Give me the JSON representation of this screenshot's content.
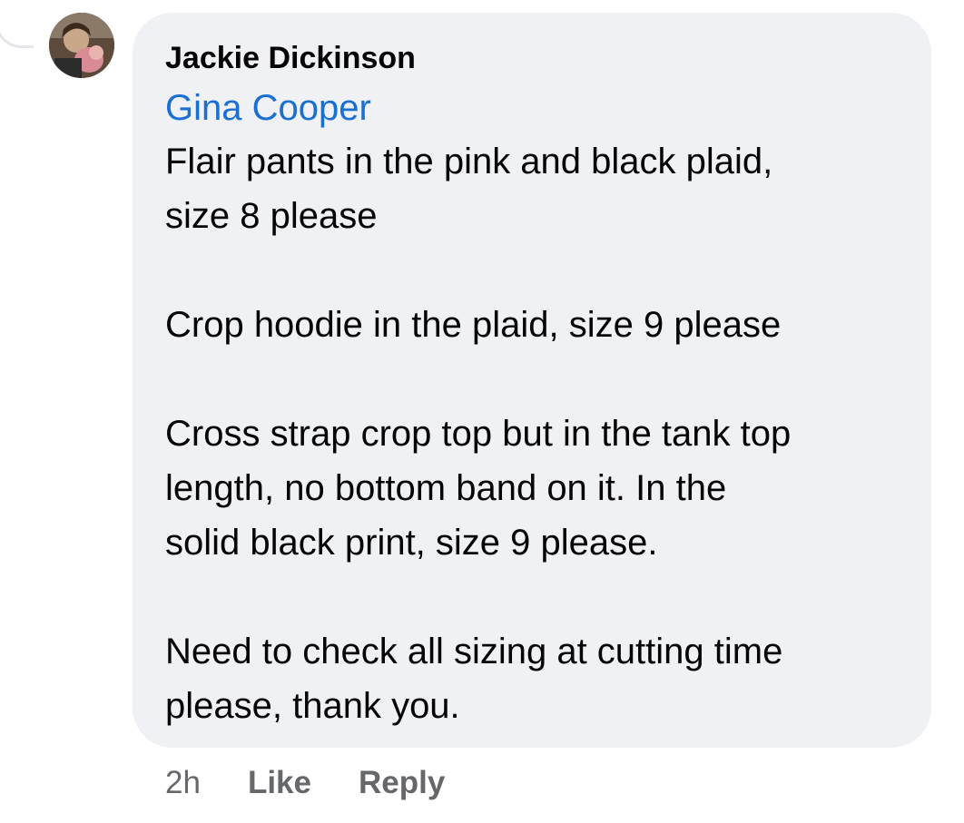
{
  "comment": {
    "author": "Jackie Dickinson",
    "mention": "Gina Cooper",
    "paragraphs": [
      [
        "Flair pants in the pink and black plaid,",
        "size 8 please"
      ],
      [
        "Crop hoodie in the plaid, size 9 please"
      ],
      [
        "Cross strap crop top but in the tank top",
        "length, no bottom band on it. In the",
        "solid black print, size 9 please."
      ],
      [
        "Need to check all sizing at cutting time",
        "please, thank you."
      ]
    ],
    "timestamp": "2h",
    "like_label": "Like",
    "reply_label": "Reply"
  }
}
